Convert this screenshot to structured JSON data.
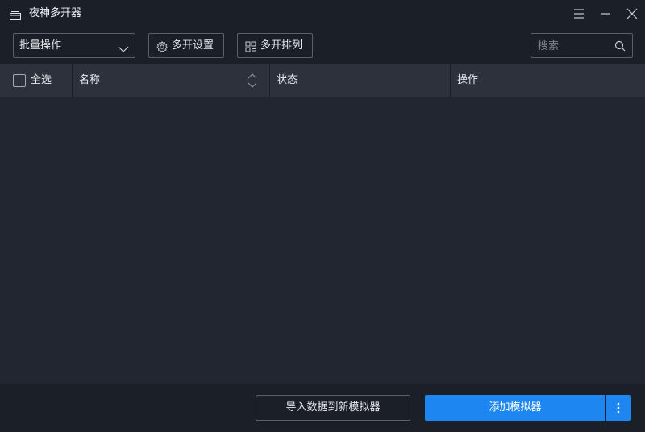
{
  "window": {
    "title": "夜神多开器",
    "app_icon": "multi-window-icon",
    "controls": [
      "menu-icon",
      "minimize-icon",
      "close-icon"
    ]
  },
  "toolbar": {
    "batch_select": {
      "value": "批量操作",
      "icon": "chevron-down-icon"
    },
    "settings_button": {
      "label": "多开设置",
      "icon": "gear-icon"
    },
    "arrange_button": {
      "label": "多开排列",
      "icon": "grid-icon"
    },
    "search": {
      "placeholder": "搜索",
      "icon": "search-icon"
    }
  },
  "table": {
    "select_all_label": "全选",
    "columns": [
      "名称",
      "状态",
      "操作"
    ],
    "rows": []
  },
  "footer": {
    "import_label": "导入数据到新模拟器",
    "add_label": "添加模拟器",
    "more_icon": "more-vertical-icon"
  },
  "colors": {
    "background": "#1b1f28",
    "header_bg": "#2c313b",
    "body_bg": "#222631",
    "border": "#5a5f6b",
    "accent": "#1e86f0"
  }
}
